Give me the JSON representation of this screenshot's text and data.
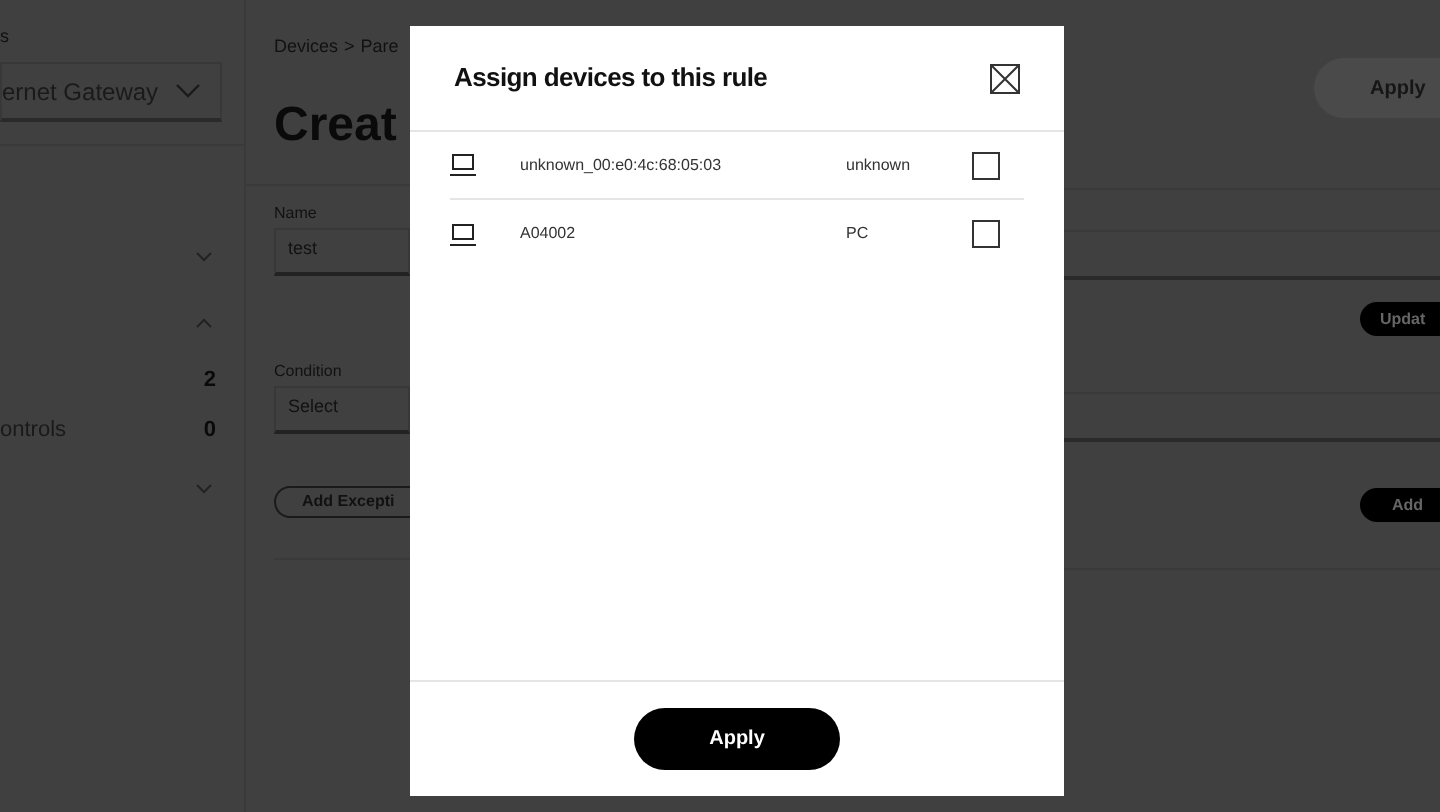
{
  "sidebar": {
    "label": "s",
    "gateway_select": "ernet Gateway",
    "items": [
      {
        "kind": "toggle",
        "expanded": false
      },
      {
        "kind": "toggle",
        "expanded": true
      },
      {
        "kind": "count",
        "count": "2"
      },
      {
        "kind": "count",
        "label": "ontrols",
        "count": "0"
      },
      {
        "kind": "toggle",
        "expanded": false
      }
    ]
  },
  "page": {
    "breadcrumb": [
      "Devices",
      ">",
      "Pare"
    ],
    "heading": "Creat",
    "apply_button": "Apply",
    "name_label": "Name",
    "name_value": "test",
    "update_button": "Updat",
    "condition_label": "Condition",
    "condition_value": "Select",
    "add_exception_button": "Add Excepti",
    "add_button": "Add"
  },
  "modal": {
    "title": "Assign devices to this rule",
    "devices": [
      {
        "name": "unknown_00:e0:4c:68:05:03",
        "type": "unknown",
        "checked": false
      },
      {
        "name": "A04002",
        "type": "PC",
        "checked": false
      }
    ],
    "apply_button": "Apply"
  }
}
